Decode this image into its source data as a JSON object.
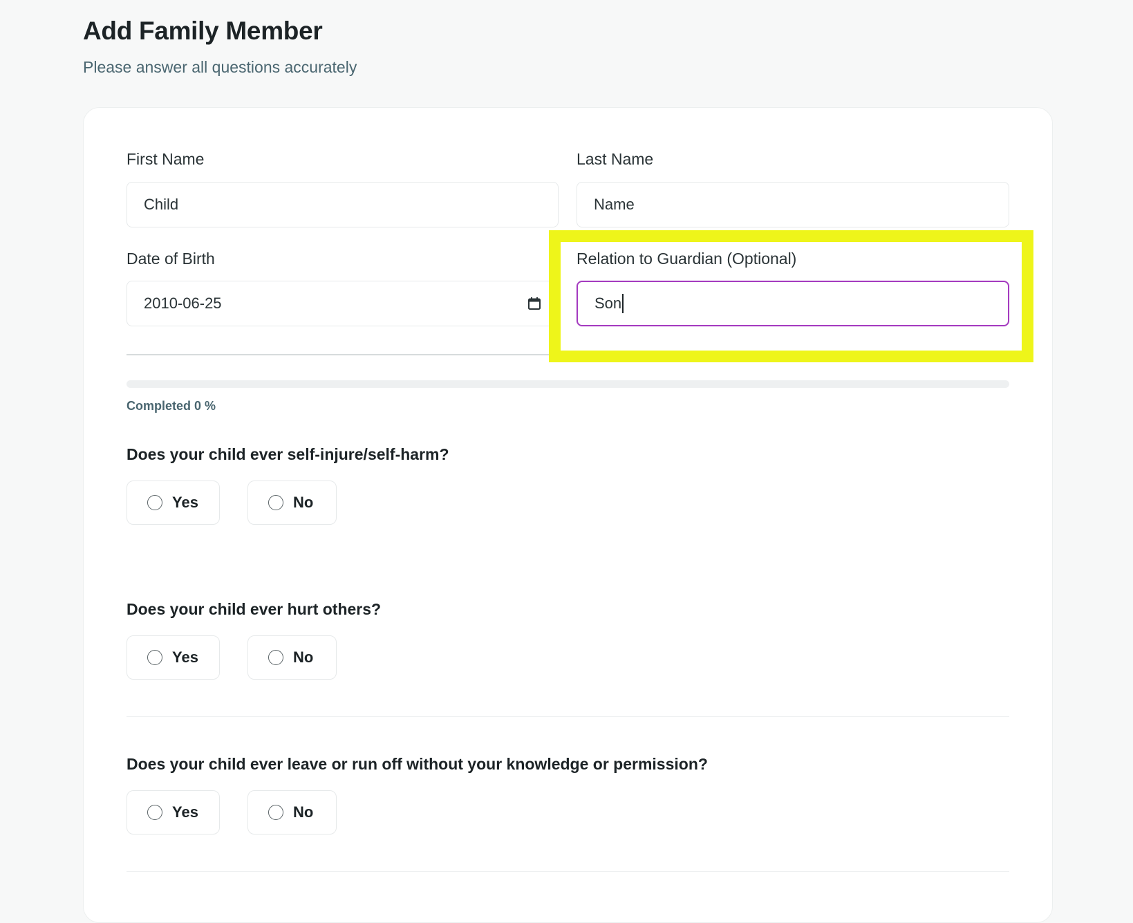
{
  "page": {
    "title": "Add Family Member",
    "subtitle": "Please answer all questions accurately"
  },
  "form": {
    "first_name": {
      "label": "First Name",
      "value": "Child"
    },
    "last_name": {
      "label": "Last Name",
      "value": "Name"
    },
    "date_of_birth": {
      "label": "Date of Birth",
      "value": "2010-06-25",
      "icon": "calendar-icon"
    },
    "relation": {
      "label": "Relation to Guardian (Optional)",
      "value": "Son",
      "focused": true
    }
  },
  "progress": {
    "text": "Completed 0 %",
    "percent": 0,
    "fill_color": "#4a6670"
  },
  "questions": [
    {
      "text": "Does your child ever self-injure/self-harm?",
      "options": [
        {
          "label": "Yes"
        },
        {
          "label": "No"
        }
      ]
    },
    {
      "text": "Does your child ever hurt others?",
      "options": [
        {
          "label": "Yes"
        },
        {
          "label": "No"
        }
      ]
    },
    {
      "text": "Does your child ever leave or run off without your knowledge or permission?",
      "options": [
        {
          "label": "Yes"
        },
        {
          "label": "No"
        }
      ]
    }
  ],
  "colors": {
    "focus_border": "#a53cc0",
    "highlight": "#eef51a",
    "subtitle": "#4a6670"
  }
}
